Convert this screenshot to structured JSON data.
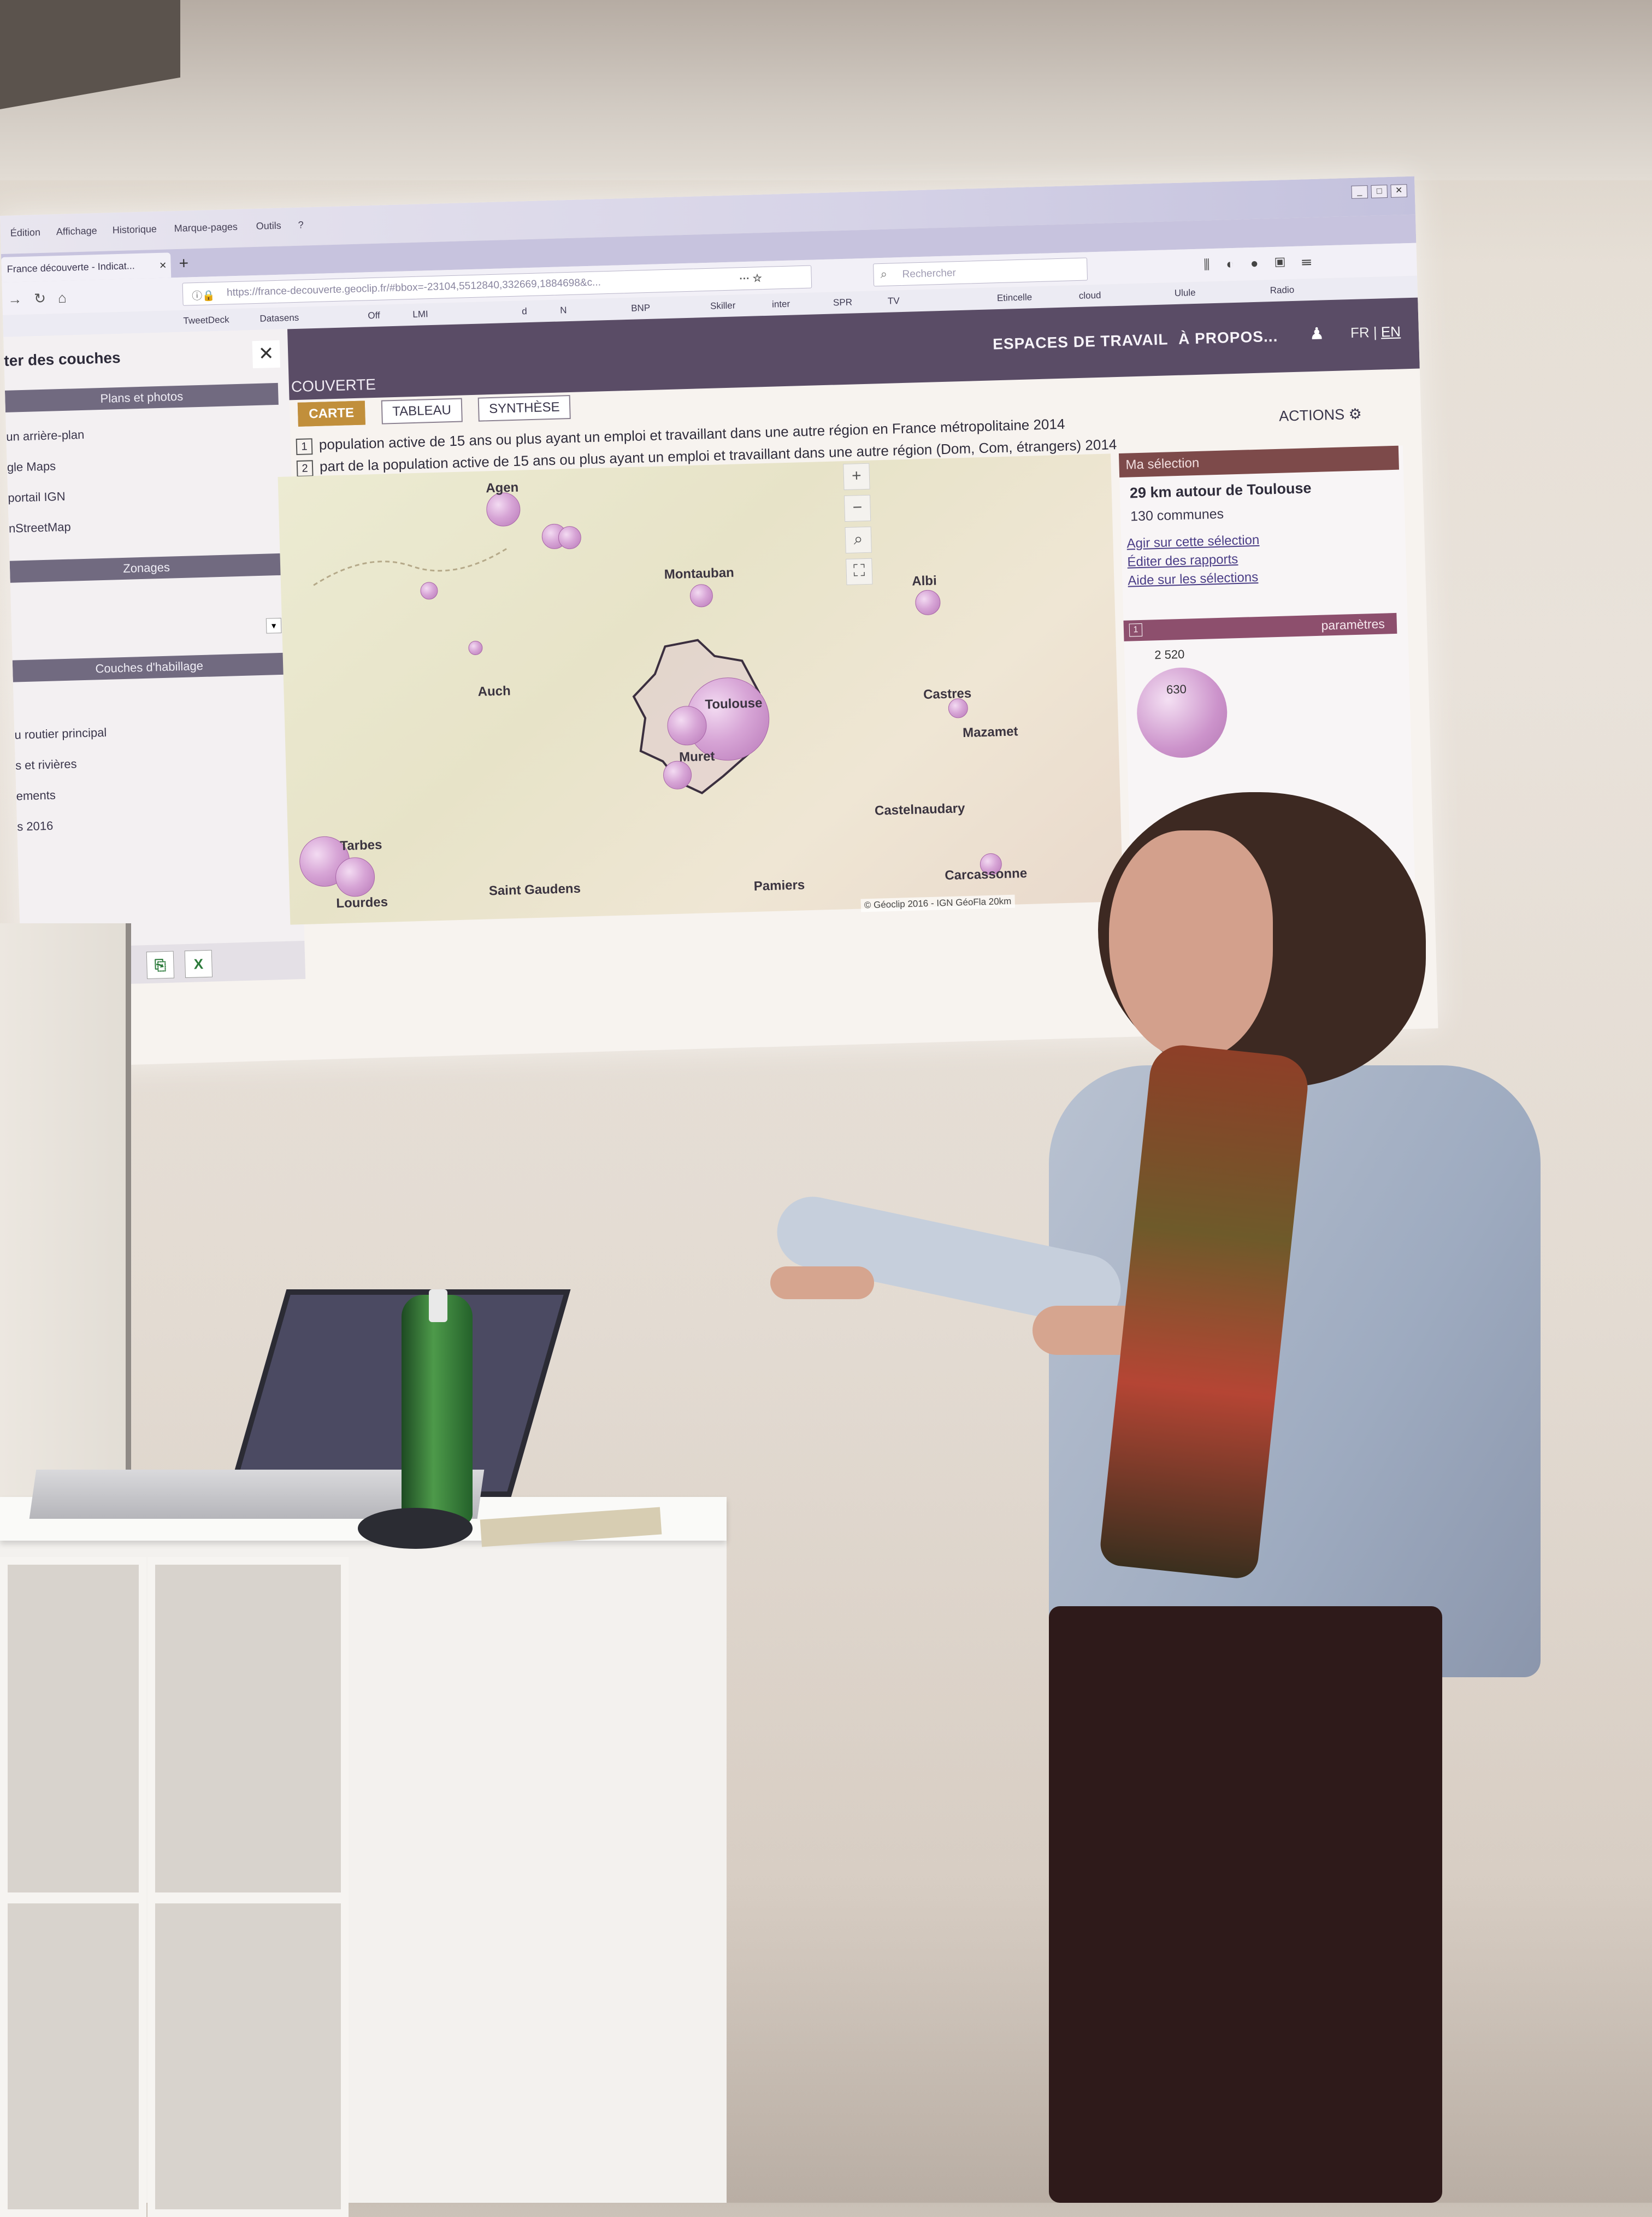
{
  "browser": {
    "menu": [
      "Édition",
      "Affichage",
      "Historique",
      "Marque-pages",
      "Outils",
      "?"
    ],
    "window_buttons": [
      "_",
      "□",
      "✕"
    ],
    "tab_title": "France découverte - Indicat...",
    "url": "https://france-decouverte.geoclip.fr/#bbox=-23104,5512840,332669,1884698&c...",
    "search_placeholder": "Rechercher",
    "bookmarks": [
      "TweetDeck",
      "Datasens",
      "Off",
      "LMI",
      "d",
      "N",
      "BNP",
      "Skiller",
      "inter",
      "SPR",
      "TV",
      "Etincelle",
      "cloud",
      "Ulule",
      "Radio"
    ]
  },
  "side_panel": {
    "title": "ter des couches",
    "close": "✕",
    "sections": [
      {
        "header": "Plans et photos",
        "items": [
          "un arrière-plan",
          "gle Maps",
          "portail IGN",
          "nStreetMap"
        ]
      },
      {
        "header": "Zonages",
        "items": []
      },
      {
        "header": "Couches d'habillage",
        "items": [
          "u routier principal",
          "s et rivières",
          "ements",
          "s 2016"
        ]
      }
    ]
  },
  "header": {
    "brand": "COUVERTE",
    "nav": [
      "ESPACES DE TRAVAIL",
      "À PROPOS..."
    ],
    "lang_fr": "FR",
    "lang_sep": "|",
    "lang_en": "EN"
  },
  "view_tabs": [
    "CARTE",
    "TABLEAU",
    "SYNTHÈSE"
  ],
  "indicators": [
    {
      "num": "1",
      "label": "population active de 15 ans ou plus ayant un emploi et travaillant dans une autre région en France métropolitaine 2014"
    },
    {
      "num": "2",
      "label": "part de la population active de 15 ans ou plus ayant un emploi et travaillant dans une autre région (Dom, Com, étrangers) 2014"
    }
  ],
  "actions_label": "ACTIONS",
  "map": {
    "controls": [
      "+",
      "−",
      "⌕",
      "⛶"
    ],
    "cities": [
      "Agen",
      "Montauban",
      "Albi",
      "Auch",
      "Toulouse",
      "Muret",
      "Castres",
      "Mazamet",
      "Castelnaudary",
      "Tarbes",
      "Lourdes",
      "Saint Gaudens",
      "Pamiers",
      "Carcassonne"
    ],
    "attribution": "© Géoclip 2016 - IGN GéoFla   20km"
  },
  "selection": {
    "header": "Ma sélection",
    "title": "29 km autour de Toulouse",
    "subtitle": "130 communes",
    "links": [
      "Agir sur cette sélection",
      "Éditer des rapports",
      "Aide sur les sélections"
    ],
    "param_num": "1",
    "param_label": "paramètres",
    "legend_max": "2 520",
    "legend_mid": "630"
  },
  "colors": {
    "header": "#5a4c66",
    "active_tab": "#c18f3b",
    "bubble": "#c58cc4",
    "selection_head": "#7d4a4a"
  }
}
